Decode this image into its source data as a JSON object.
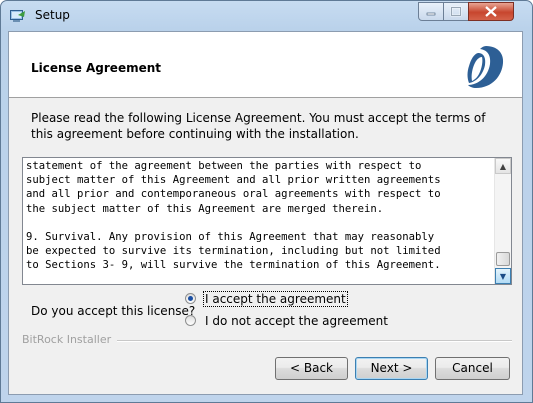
{
  "window": {
    "title": "Setup",
    "min_icon": "minimize-icon",
    "max_icon": "maximize-icon",
    "close_icon": "close-icon"
  },
  "header": {
    "title": "License Agreement",
    "logo_icon": "bitrock-logo"
  },
  "intro": "Please read the following License Agreement. You must accept the terms of this agreement before continuing with the installation.",
  "license_text": "statement of the agreement between the parties with respect to\nsubject matter of this Agreement and all prior written agreements\nand all prior and contemporaneous oral agreements with respect to\nthe subject matter of this Agreement are merged therein.\n\n9. Survival. Any provision of this Agreement that may reasonably\nbe expected to survive its termination, including but not limited\nto Sections 3- 9, will survive the termination of this Agreement.",
  "question": "Do you accept this license?",
  "options": [
    {
      "label": "I accept the agreement",
      "selected": true
    },
    {
      "label": "I do not accept the agreement",
      "selected": false
    }
  ],
  "footer_label": "BitRock Installer",
  "buttons": {
    "back": "< Back",
    "next": "Next >",
    "cancel": "Cancel"
  },
  "colors": {
    "accent": "#1b4fa3",
    "logo": "#2d5f95"
  }
}
